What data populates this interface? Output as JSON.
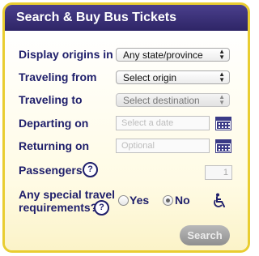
{
  "header": {
    "title": "Search & Buy Bus Tickets"
  },
  "form": {
    "display_origins": {
      "label": "Display origins in",
      "value": "Any state/province"
    },
    "traveling_from": {
      "label": "Traveling from",
      "value": "Select origin"
    },
    "traveling_to": {
      "label": "Traveling to",
      "value": "Select destination"
    },
    "departing_on": {
      "label": "Departing on",
      "placeholder": "Select a date"
    },
    "returning_on": {
      "label": "Returning on",
      "placeholder": "Optional"
    },
    "passengers": {
      "label": "Passengers",
      "value": "1",
      "help": "?"
    },
    "special": {
      "label_line1": "Any special travel",
      "label_line2": "requirements?",
      "help": "?",
      "yes_label": "Yes",
      "no_label": "No",
      "selected": "No"
    },
    "search_label": "Search"
  },
  "colors": {
    "header_bg": "#2e2566",
    "border": "#e9cd31",
    "label_text": "#1f1f6b"
  },
  "icons": [
    "calendar-icon",
    "help-icon",
    "wheelchair-icon",
    "select-arrows-icon"
  ]
}
